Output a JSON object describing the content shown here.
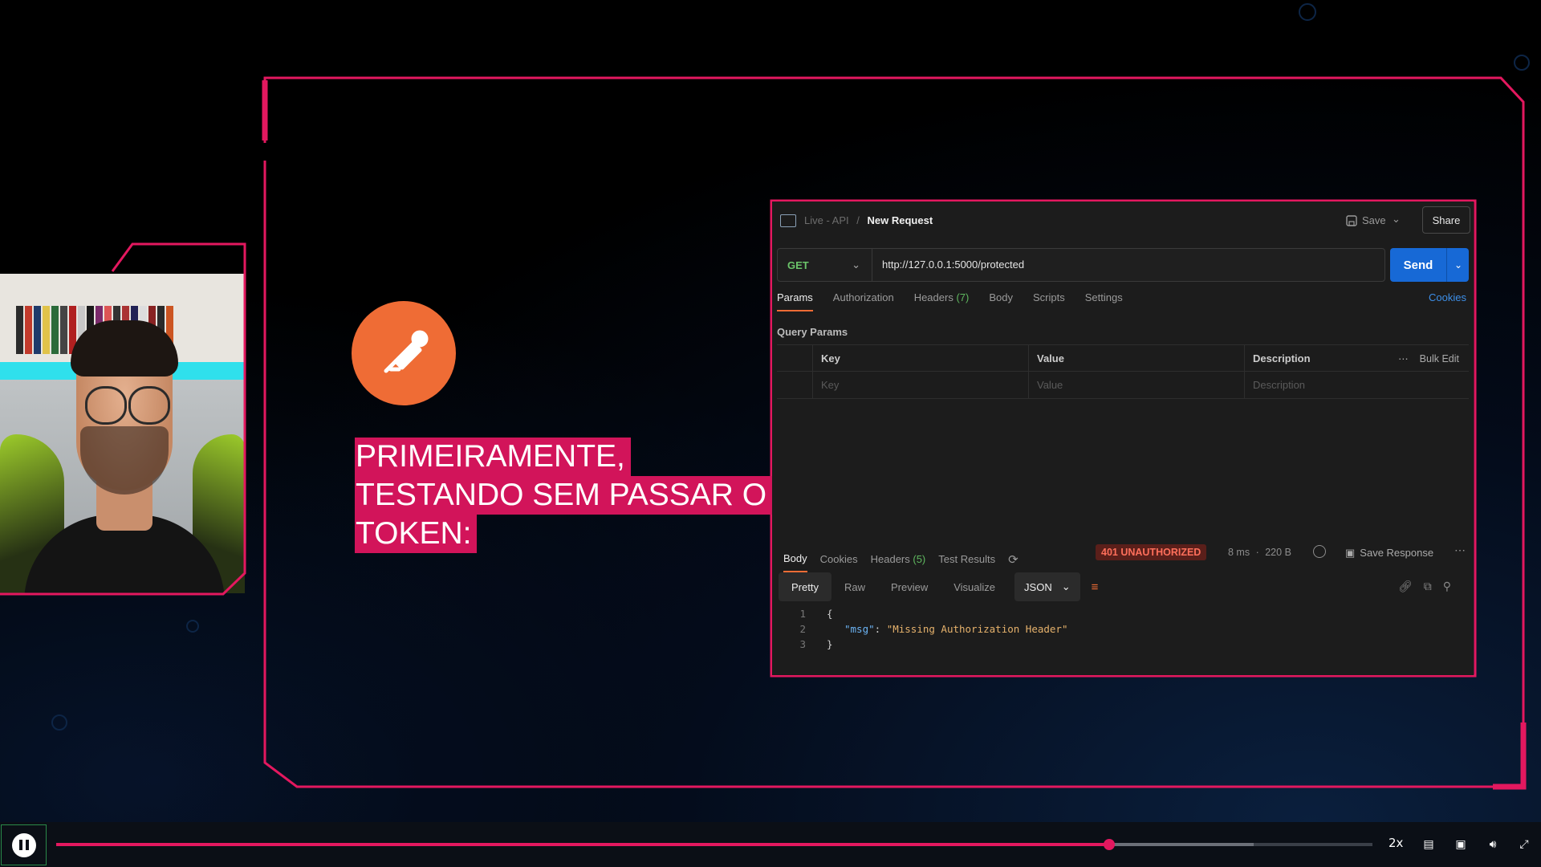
{
  "caption": {
    "line1": "PRIMEIRAMENTE,",
    "line2": "TESTANDO SEM PASSAR O",
    "line3": "TOKEN:"
  },
  "postman": {
    "breadcrumb": {
      "collection": "Live - API",
      "separator": "/",
      "request": "New Request"
    },
    "save_label": "Save",
    "share_label": "Share",
    "method": "GET",
    "url": "http://127.0.0.1:5000/protected",
    "send_label": "Send",
    "tabs": [
      {
        "label": "Params"
      },
      {
        "label": "Authorization"
      },
      {
        "label": "Headers",
        "count": "(7)"
      },
      {
        "label": "Body"
      },
      {
        "label": "Scripts"
      },
      {
        "label": "Settings"
      }
    ],
    "cookies_label": "Cookies",
    "query_params_label": "Query Params",
    "table": {
      "headers": [
        "Key",
        "Value",
        "Description"
      ],
      "bulk_edit": "Bulk Edit",
      "placeholders": [
        "Key",
        "Value",
        "Description"
      ]
    },
    "response": {
      "tabs": [
        {
          "label": "Body"
        },
        {
          "label": "Cookies"
        },
        {
          "label": "Headers",
          "count": "(5)"
        },
        {
          "label": "Test Results"
        }
      ],
      "status": "401 UNAUTHORIZED",
      "time": "8 ms",
      "size": "220 B",
      "save_response": "Save Response",
      "view_tabs": [
        "Pretty",
        "Raw",
        "Preview",
        "Visualize"
      ],
      "format": "JSON",
      "body_lines": [
        {
          "n": "1",
          "text": "{"
        },
        {
          "n": "2",
          "key": "\"msg\"",
          "colon": ": ",
          "value": "\"Missing Authorization Header\""
        },
        {
          "n": "3",
          "text": "}"
        }
      ]
    }
  },
  "player": {
    "speed": "2x",
    "progress": 0.8,
    "buffered": 0.91,
    "icons": [
      "pause-icon",
      "subtitles-icon",
      "picture-in-picture-icon",
      "volume-icon",
      "fullscreen-exit-icon"
    ]
  },
  "colors": {
    "frame": "#e3185f",
    "postman_orange": "#ef6c35",
    "send_blue": "#1769d6",
    "status_red": "#ff6f5b",
    "caption_bg": "#d2145a"
  }
}
